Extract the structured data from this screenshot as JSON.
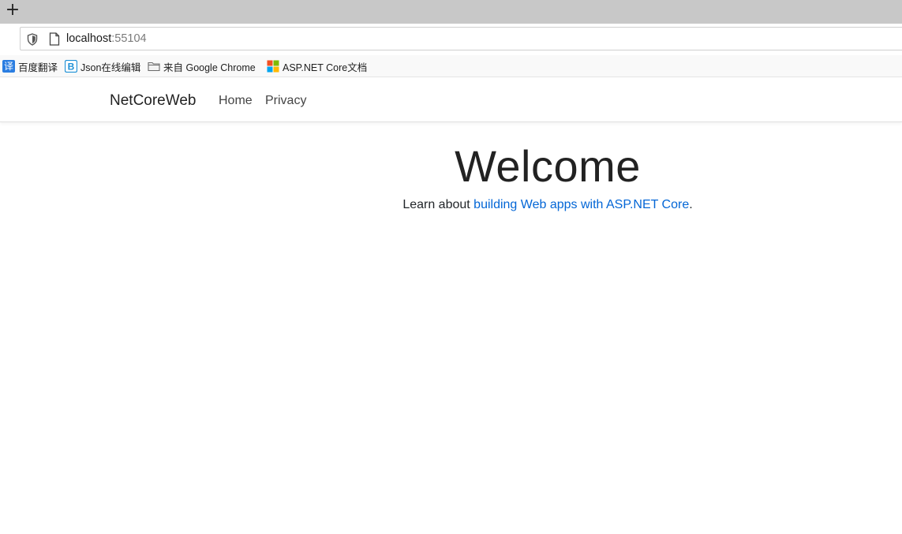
{
  "browser": {
    "new_tab_label": "+",
    "url_host": "localhost",
    "url_port": ":55104",
    "bookmarks": [
      {
        "label": "百度翻译",
        "icon": "baidu-translate-icon"
      },
      {
        "label": "Json在线编辑",
        "icon": "json-editor-icon"
      },
      {
        "label": "来自 Google Chrome",
        "icon": "folder-icon"
      },
      {
        "label": "ASP.NET Core文档",
        "icon": "microsoft-icon"
      }
    ]
  },
  "site": {
    "brand": "NetCoreWeb",
    "nav": [
      "Home",
      "Privacy"
    ]
  },
  "main": {
    "heading": "Welcome",
    "learn_prefix": "Learn about ",
    "learn_link": "building Web apps with ASP.NET Core",
    "learn_suffix": "."
  },
  "colors": {
    "link": "#0366d6",
    "tabstrip": "#c8c8c8"
  }
}
